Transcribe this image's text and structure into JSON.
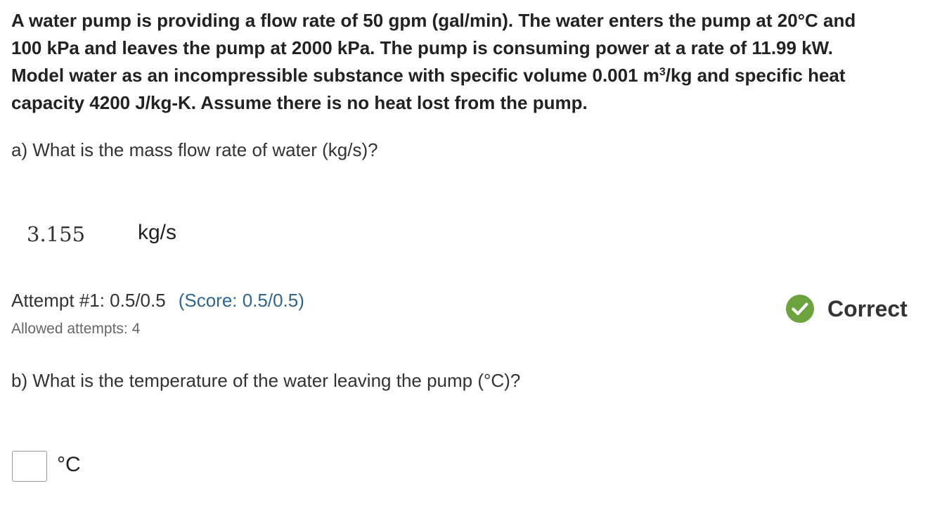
{
  "problem": {
    "line1": "A water pump is providing a flow rate of 50 gpm (gal/min).  The water enters the pump at 20°C and",
    "line2": "100 kPa and leaves the pump at 2000 kPa.  The pump is consuming power at a rate of 11.99 kW.",
    "line3_before": "Model water as an incompressible substance with specific volume 0.001 m",
    "line3_sup": "3",
    "line3_after": "/kg and specific heat",
    "line4": "capacity 4200 J/kg-K.   Assume there is no heat lost from the pump."
  },
  "part_a": {
    "question": "a) What is the mass flow rate of water (kg/s)?",
    "answer_value": "3.155",
    "unit": "kg/s",
    "attempt_text": "Attempt #1: 0.5/0.5",
    "score_text": "(Score: 0.5/0.5)",
    "allowed_attempts": "Allowed attempts: 4",
    "status_label": "Correct",
    "status_icon": "check-circle-icon",
    "status_color": "#6ca33f"
  },
  "part_b": {
    "question": "b) What is the temperature of the water leaving the pump (°C)?",
    "input_value": "",
    "unit": "°C"
  },
  "colors": {
    "text": "#222222",
    "score": "#2f6690",
    "muted": "#666666",
    "correct": "#6ca33f"
  }
}
